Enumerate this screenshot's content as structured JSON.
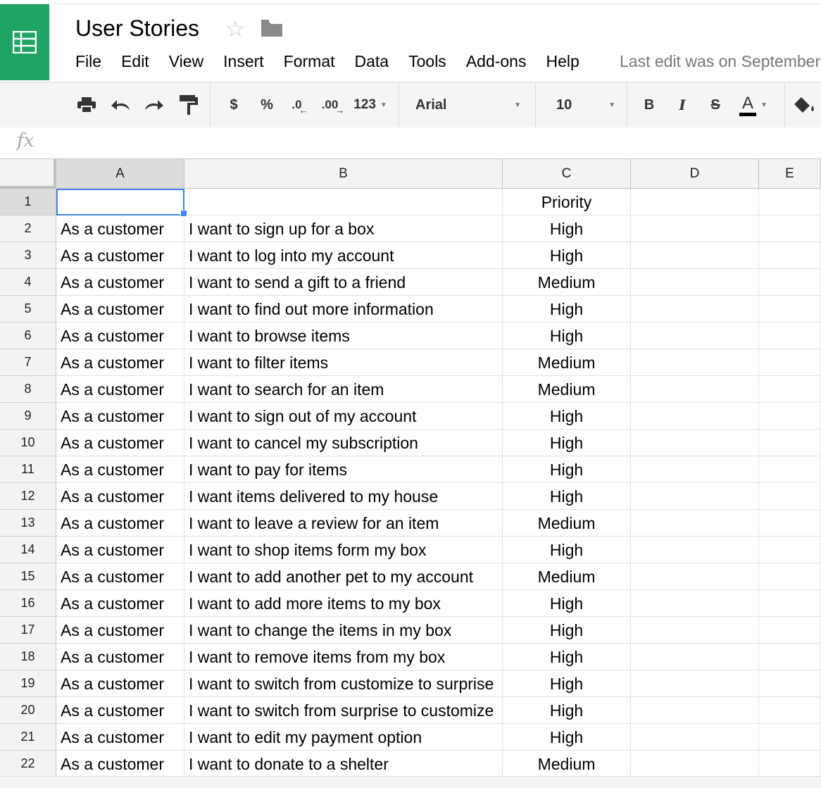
{
  "app": {
    "title": "User Stories",
    "last_edit": "Last edit was on September"
  },
  "menu": [
    "File",
    "Edit",
    "View",
    "Insert",
    "Format",
    "Data",
    "Tools",
    "Add-ons",
    "Help"
  ],
  "toolbar": {
    "currency": "$",
    "percent": "%",
    "decrease_decimal": ".0",
    "increase_decimal": ".00",
    "more_formats": "123",
    "font": "Arial",
    "font_size": "10",
    "bold": "B",
    "italic": "I",
    "strikethrough": "S",
    "text_color": "A"
  },
  "formula_bar": {
    "fx": "fx",
    "value": ""
  },
  "columns": [
    "A",
    "B",
    "C",
    "D",
    "E"
  ],
  "rows": [
    {
      "n": "1",
      "a": "",
      "b": "",
      "c": "Priority"
    },
    {
      "n": "2",
      "a": "As a customer",
      "b": "I want to sign up for a box",
      "c": "High"
    },
    {
      "n": "3",
      "a": "As a customer",
      "b": "I want to log into my account",
      "c": "High"
    },
    {
      "n": "4",
      "a": "As a customer",
      "b": "I want to send a gift to a friend",
      "c": "Medium"
    },
    {
      "n": "5",
      "a": "As a customer",
      "b": "I want to find out more information",
      "c": "High"
    },
    {
      "n": "6",
      "a": "As a customer",
      "b": "I want to browse items",
      "c": "High"
    },
    {
      "n": "7",
      "a": "As a customer",
      "b": "I want to filter items",
      "c": "Medium"
    },
    {
      "n": "8",
      "a": "As a customer",
      "b": "I want to search for an item",
      "c": "Medium"
    },
    {
      "n": "9",
      "a": "As a customer",
      "b": "I want to sign out of my account",
      "c": "High"
    },
    {
      "n": "10",
      "a": "As a customer",
      "b": "I want to cancel my subscription",
      "c": "High"
    },
    {
      "n": "11",
      "a": "As a customer",
      "b": "I want to pay for items",
      "c": "High"
    },
    {
      "n": "12",
      "a": "As a customer",
      "b": "I want items delivered to my house",
      "c": "High"
    },
    {
      "n": "13",
      "a": "As a customer",
      "b": "I want to leave a review for an item",
      "c": "Medium"
    },
    {
      "n": "14",
      "a": "As a customer",
      "b": "I want to shop items form my box",
      "c": "High"
    },
    {
      "n": "15",
      "a": "As a customer",
      "b": "I want to add another pet to my account",
      "c": "Medium"
    },
    {
      "n": "16",
      "a": "As a customer",
      "b": "I want to add more items to my box",
      "c": "High"
    },
    {
      "n": "17",
      "a": "As a customer",
      "b": "I want to change the items in my box",
      "c": "High"
    },
    {
      "n": "18",
      "a": "As a customer",
      "b": "I want to remove items from my box",
      "c": "High"
    },
    {
      "n": "19",
      "a": "As a customer",
      "b": "I want to switch from customize to surprise",
      "c": "High"
    },
    {
      "n": "20",
      "a": "As a customer",
      "b": "I want to switch from surprise to customize",
      "c": "High"
    },
    {
      "n": "21",
      "a": "As a customer",
      "b": "I want to edit my payment option",
      "c": "High"
    },
    {
      "n": "22",
      "a": "As a customer",
      "b": "I want to donate to a shelter",
      "c": "Medium"
    }
  ],
  "colors": {
    "brand": "#1fa463",
    "selection": "#4285f4"
  }
}
